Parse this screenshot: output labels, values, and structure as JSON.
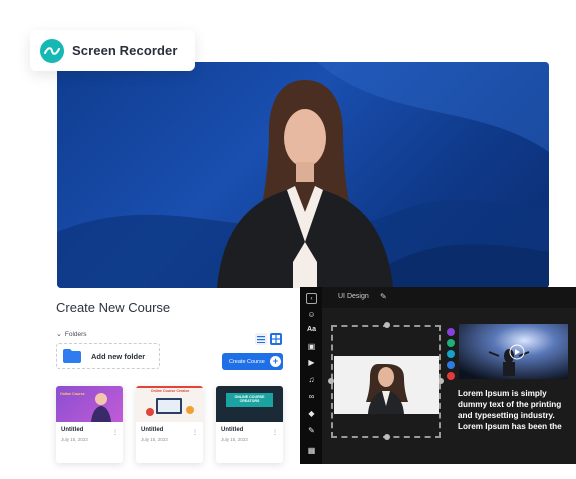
{
  "app": {
    "title": "Screen Recorder",
    "brand_color": "#16b8b3",
    "logo_icon": "wave-logo-icon"
  },
  "hero": {
    "background_color": "#1a4fb0",
    "content": "presenter-video-frame"
  },
  "course_panel": {
    "title": "Create New Course",
    "folders_label": "Folders",
    "add_folder_label": "Add new folder",
    "create_course_label": "Create Course",
    "accent_color": "#1f6fe6",
    "view_modes": [
      "list-view-icon",
      "grid-view-icon"
    ],
    "cards": [
      {
        "name": "Untitled",
        "date": "July 15, 2023",
        "thumb_text": "Online Course"
      },
      {
        "name": "Untitled",
        "date": "July 15, 2023",
        "thumb_text": "Online Course Creator"
      },
      {
        "name": "Untitled",
        "date": "July 15, 2023",
        "thumb_text": "ONLINE COURSE CREATORS"
      }
    ]
  },
  "editor": {
    "title": "UI Design",
    "toolbar_icons": [
      "collapse-icon",
      "avatar-icon",
      "text-icon",
      "image-icon",
      "video-icon",
      "music-icon",
      "link-icon",
      "shapes-icon",
      "brush-icon",
      "qr-code-icon"
    ],
    "side_tool_colors": [
      "#8a3fe0",
      "#1fb07a",
      "#17a3c9",
      "#2d7be0",
      "#e23b3b"
    ],
    "caption": "Lorem Ipsum is simply dummy text of the printing and typesetting industry. Lorem Ipsum has been the"
  }
}
